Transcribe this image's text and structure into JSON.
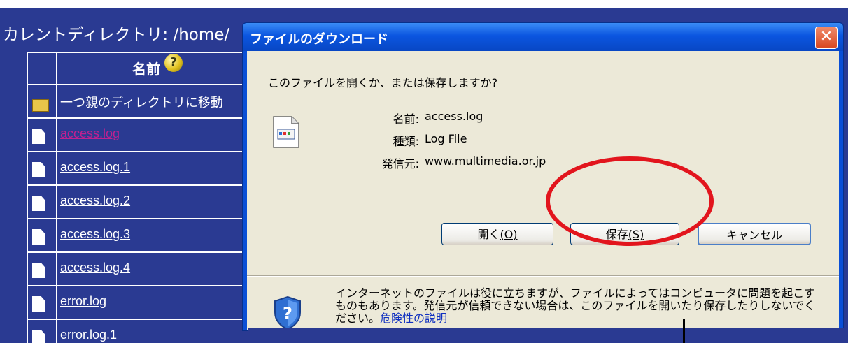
{
  "browser": {
    "current_dir_label": "カレントディレクトリ: /home/",
    "column_header": "名前",
    "help_icon_glyph": "?",
    "rows": [
      {
        "name": "一つ親のディレクトリに移動",
        "type": "folder",
        "visited": false
      },
      {
        "name": "access.log",
        "type": "file",
        "visited": true
      },
      {
        "name": "access.log.1",
        "type": "file",
        "visited": false
      },
      {
        "name": "access.log.2",
        "type": "file",
        "visited": false
      },
      {
        "name": "access.log.3",
        "type": "file",
        "visited": false
      },
      {
        "name": "access.log.4",
        "type": "file",
        "visited": false
      },
      {
        "name": "error.log",
        "type": "file",
        "visited": false
      },
      {
        "name": "error.log.1",
        "type": "file",
        "visited": false
      }
    ]
  },
  "dialog": {
    "title": "ファイルのダウンロード",
    "close_glyph": "✕",
    "question": "このファイルを開くか、または保存しますか?",
    "file_labels": {
      "name_label": "名前:",
      "type_label": "種類:",
      "source_label": "発信元:"
    },
    "file_values": {
      "name": "access.log",
      "type": "Log File",
      "source": "www.multimedia.or.jp"
    },
    "buttons": {
      "open_text": "開く",
      "open_key": "(O)",
      "save_text": "保存",
      "save_key": "(S)",
      "cancel": "キャンセル"
    },
    "warning_text": "インターネットのファイルは役に立ちますが、ファイルによってはコンピュータに問題を起こすものもあります。発信元が信頼できない場合は、このファイルを開いたり保存したりしないでください。",
    "warning_link": "危険性の説明"
  },
  "colors": {
    "browser_bg": "#2a3a92",
    "titlebar": "#0b55e0",
    "dialog_body": "#ece9d8",
    "annotation": "#e2151d"
  }
}
